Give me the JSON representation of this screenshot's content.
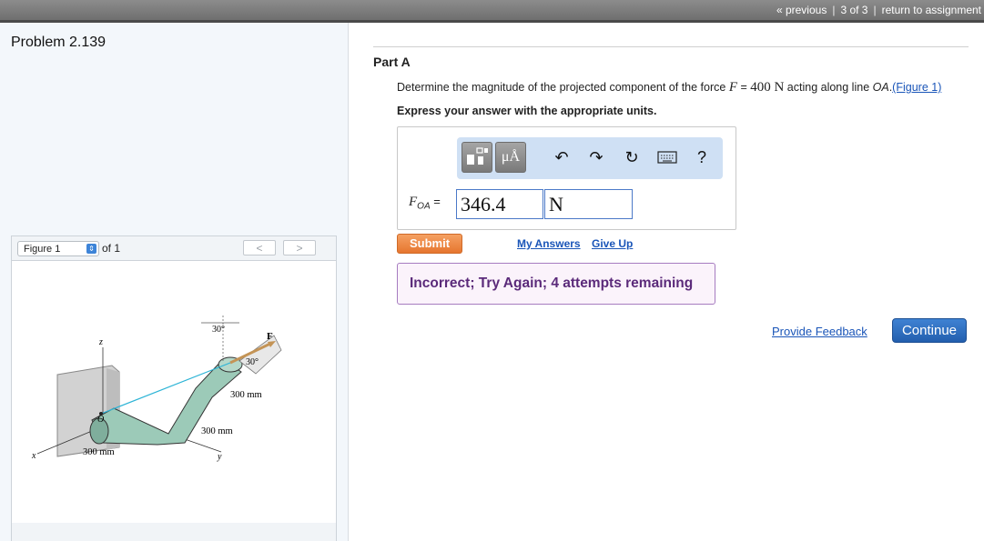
{
  "nav": {
    "previous": "« previous",
    "position": "3 of 3",
    "return": "return to assignment"
  },
  "problem": {
    "title": "Problem 2.139"
  },
  "figure_panel": {
    "select_value": "Figure 1",
    "of_label": "of 1",
    "prev_glyph": "<",
    "next_glyph": ">"
  },
  "figure": {
    "angle_top": "30°",
    "angle_arm": "30°",
    "force_label": "F",
    "axis_z": "z",
    "axis_x": "x",
    "axis_y": "y",
    "origin_label": "O",
    "dim_vertical": "300 mm",
    "dim_middle": "300 mm",
    "dim_base": "300 mm"
  },
  "part": {
    "title": "Part A",
    "question_before": "Determine the magnitude of the projected component of the force ",
    "force_symbol": "F",
    "equals": " = ",
    "force_value": "400 N",
    "question_after": " acting along line ",
    "line_name": "OA",
    "period": ".",
    "figure_link": "(Figure 1)",
    "instruction": "Express your answer with the appropriate units."
  },
  "answer": {
    "label_main": "F",
    "label_sub": "OA",
    "label_equals": " =",
    "value": "346.4",
    "unit": "N"
  },
  "toolbar": {
    "units_label": "μÅ",
    "help_label": "?"
  },
  "actions": {
    "submit": "Submit",
    "my_answers": "My Answers",
    "give_up": "Give Up",
    "feedback": "Incorrect; Try Again; 4 attempts remaining",
    "provide_feedback": "Provide Feedback",
    "continue": "Continue"
  },
  "colors": {
    "accent_blue": "#2a66b5",
    "submit_orange": "#ee8741",
    "feedback_purple": "#5b2a7a",
    "pipe_green": "#9ccab8"
  }
}
